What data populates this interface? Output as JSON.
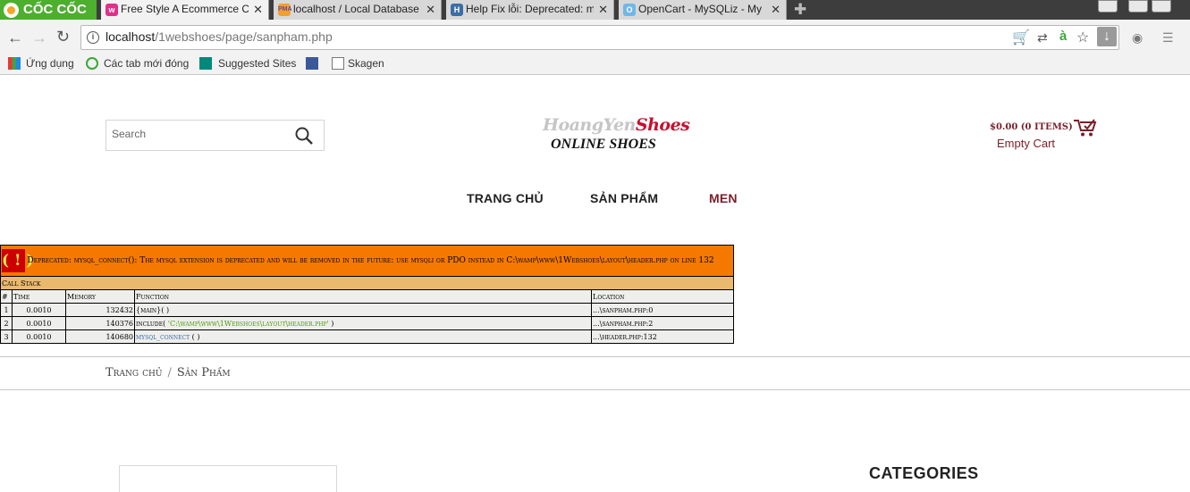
{
  "browser": {
    "brand": "CỐC CỐC",
    "tabs": [
      {
        "title": "Free Style A Ecommerce C",
        "active": true
      },
      {
        "title": "localhost / Local Database",
        "active": false
      },
      {
        "title": "Help Fix lỗi: Deprecated: m",
        "active": false
      },
      {
        "title": "OpenCart - MySQLiz - My",
        "active": false
      }
    ],
    "url_host": "localhost",
    "url_path": "/1webshoes/page/sanpham.php",
    "bookmarks": [
      "Ứng dụng",
      "Các tab mới đóng",
      "Suggested Sites",
      "Skagen"
    ]
  },
  "header": {
    "search_placeholder": "Search",
    "logo_part1": "HoangYen",
    "logo_part2": "Shoes",
    "logo_subtitle": "ONLINE SHOES",
    "cart_total": "$0.00 (0 ITEMS)",
    "cart_status": "Empty Cart"
  },
  "nav": [
    "TRANG CHỦ",
    "SẢN PHẨM",
    "MEN"
  ],
  "php_error": {
    "marker": "( ! )",
    "message": "Deprecated: mysql_connect(): The mysql extension is deprecated and will be removed in the future: use mysqli or PDO instead in C:\\wamp\\www\\1Webshoes\\layout\\header.php on line 132",
    "call_stack_label": "Call Stack",
    "columns": [
      "#",
      "Time",
      "Memory",
      "Function",
      "Location"
    ],
    "rows": [
      {
        "n": "1",
        "time": "0.0010",
        "memory": "132432",
        "function": "{main}( )",
        "location": "...\\sanpham.php:0"
      },
      {
        "n": "2",
        "time": "0.0010",
        "memory": "140376",
        "function_prefix": "include( ",
        "function_arg": "'C:\\wamp\\www\\1Webshoes\\layout\\header.php'",
        "function_suffix": " )",
        "location": "...\\sanpham.php:2"
      },
      {
        "n": "3",
        "time": "0.0010",
        "memory": "140680",
        "function_link": "mysql_connect",
        "function_suffix": " ( )",
        "location": "...\\header.php:132"
      }
    ]
  },
  "breadcrumb": {
    "home": "Trang chủ",
    "separator": "/",
    "current": "Sản Phẩm"
  },
  "sidebar": {
    "categories_title": "CATEGORIES"
  }
}
